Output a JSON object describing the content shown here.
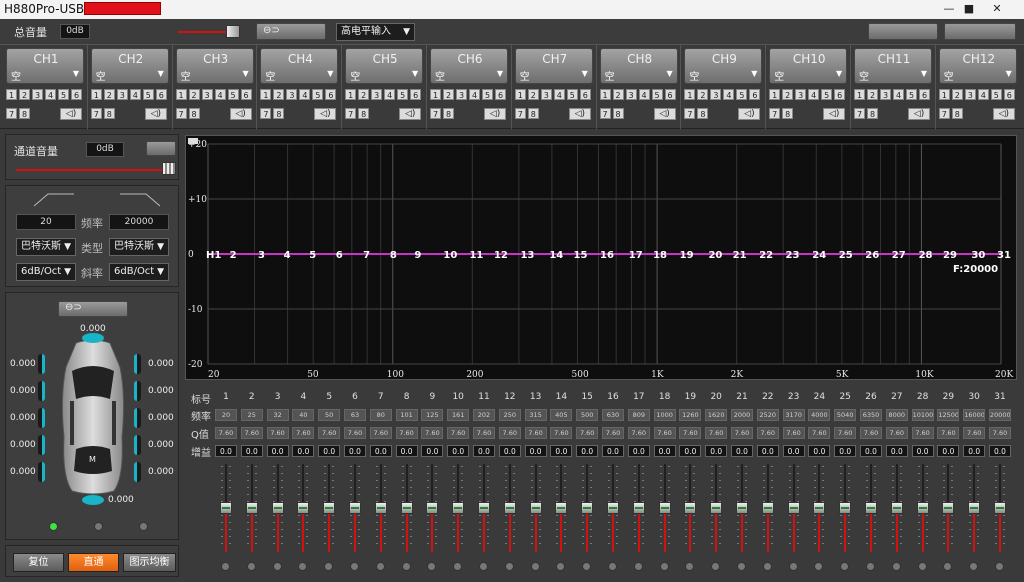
{
  "window": {
    "title": "H880Pro-USB",
    "min": "—",
    "max": "■",
    "close": "✕"
  },
  "topbar": {
    "master_label": "总音量",
    "master_value": "0dB",
    "input_mode": "高电平输入",
    "dropdown_arrow": "▼"
  },
  "channels": [
    {
      "name": "CH1",
      "sub": "空"
    },
    {
      "name": "CH2",
      "sub": "空"
    },
    {
      "name": "CH3",
      "sub": "空"
    },
    {
      "name": "CH4",
      "sub": "空"
    },
    {
      "name": "CH5",
      "sub": "空"
    },
    {
      "name": "CH6",
      "sub": "空"
    },
    {
      "name": "CH7",
      "sub": "空"
    },
    {
      "name": "CH8",
      "sub": "空"
    },
    {
      "name": "CH9",
      "sub": "空"
    },
    {
      "name": "CH10",
      "sub": "空"
    },
    {
      "name": "CH11",
      "sub": "空"
    },
    {
      "name": "CH12",
      "sub": "空"
    }
  ],
  "channel_inputs": [
    "1",
    "2",
    "3",
    "4",
    "5",
    "6",
    "7",
    "8"
  ],
  "channel_vol": {
    "label": "通道音量",
    "value": "0dB"
  },
  "filter": {
    "low_freq": "20",
    "freq_label": "频率",
    "high_freq": "20000",
    "type_label": "类型",
    "low_type": "巴特沃斯",
    "high_type": "巴特沃斯",
    "slope_label": "斜率",
    "low_slope": "6dB/Oct",
    "high_slope": "6dB/Oct"
  },
  "car": {
    "center_value": "0.000",
    "sub_value": "0.000",
    "left_values": [
      "0.000",
      "0.000",
      "0.000",
      "0.000",
      "0.000"
    ],
    "right_values": [
      "0.000",
      "0.000",
      "0.000",
      "0.000",
      "0.000"
    ]
  },
  "buttons": {
    "reset": "复位",
    "bypass": "直通",
    "graphic_eq": "图示均衡"
  },
  "graph": {
    "y_labels": [
      "+20",
      "+10",
      "0",
      "-10",
      "-20"
    ],
    "y_values": [
      20,
      10,
      0,
      -10,
      -20
    ],
    "x_labels": [
      "20",
      "50",
      "100",
      "200",
      "500",
      "1K",
      "2K",
      "5K",
      "10K",
      "20K"
    ],
    "x_values": [
      20,
      50,
      100,
      200,
      500,
      1000,
      2000,
      5000,
      10000,
      20000
    ],
    "freq_readout": "F:20000",
    "curve_color": "#c832c8"
  },
  "eq": {
    "row_labels": {
      "index": "标号",
      "freq": "频率",
      "q": "Q值",
      "gain": "增益"
    },
    "bands": [
      {
        "n": "1",
        "f": "20",
        "q": "7.60",
        "g": "0.0"
      },
      {
        "n": "2",
        "f": "25",
        "q": "7.60",
        "g": "0.0"
      },
      {
        "n": "3",
        "f": "32",
        "q": "7.60",
        "g": "0.0"
      },
      {
        "n": "4",
        "f": "40",
        "q": "7.60",
        "g": "0.0"
      },
      {
        "n": "5",
        "f": "50",
        "q": "7.60",
        "g": "0.0"
      },
      {
        "n": "6",
        "f": "63",
        "q": "7.60",
        "g": "0.0"
      },
      {
        "n": "7",
        "f": "80",
        "q": "7.60",
        "g": "0.0"
      },
      {
        "n": "8",
        "f": "101",
        "q": "7.60",
        "g": "0.0"
      },
      {
        "n": "9",
        "f": "125",
        "q": "7.60",
        "g": "0.0"
      },
      {
        "n": "10",
        "f": "161",
        "q": "7.60",
        "g": "0.0"
      },
      {
        "n": "11",
        "f": "202",
        "q": "7.60",
        "g": "0.0"
      },
      {
        "n": "12",
        "f": "250",
        "q": "7.60",
        "g": "0.0"
      },
      {
        "n": "13",
        "f": "315",
        "q": "7.60",
        "g": "0.0"
      },
      {
        "n": "14",
        "f": "405",
        "q": "7.60",
        "g": "0.0"
      },
      {
        "n": "15",
        "f": "500",
        "q": "7.60",
        "g": "0.0"
      },
      {
        "n": "16",
        "f": "630",
        "q": "7.60",
        "g": "0.0"
      },
      {
        "n": "17",
        "f": "809",
        "q": "7.60",
        "g": "0.0"
      },
      {
        "n": "18",
        "f": "1000",
        "q": "7.60",
        "g": "0.0"
      },
      {
        "n": "19",
        "f": "1260",
        "q": "7.60",
        "g": "0.0"
      },
      {
        "n": "20",
        "f": "1620",
        "q": "7.60",
        "g": "0.0"
      },
      {
        "n": "21",
        "f": "2000",
        "q": "7.60",
        "g": "0.0"
      },
      {
        "n": "22",
        "f": "2520",
        "q": "7.60",
        "g": "0.0"
      },
      {
        "n": "23",
        "f": "3170",
        "q": "7.60",
        "g": "0.0"
      },
      {
        "n": "24",
        "f": "4000",
        "q": "7.60",
        "g": "0.0"
      },
      {
        "n": "25",
        "f": "5040",
        "q": "7.60",
        "g": "0.0"
      },
      {
        "n": "26",
        "f": "6350",
        "q": "7.60",
        "g": "0.0"
      },
      {
        "n": "27",
        "f": "8000",
        "q": "7.60",
        "g": "0.0"
      },
      {
        "n": "28",
        "f": "10100",
        "q": "7.60",
        "g": "0.0"
      },
      {
        "n": "29",
        "f": "12500",
        "q": "7.60",
        "g": "0.0"
      },
      {
        "n": "30",
        "f": "16000",
        "q": "7.60",
        "g": "0.0"
      },
      {
        "n": "31",
        "f": "20000",
        "q": "7.60",
        "g": "0.0"
      }
    ]
  }
}
